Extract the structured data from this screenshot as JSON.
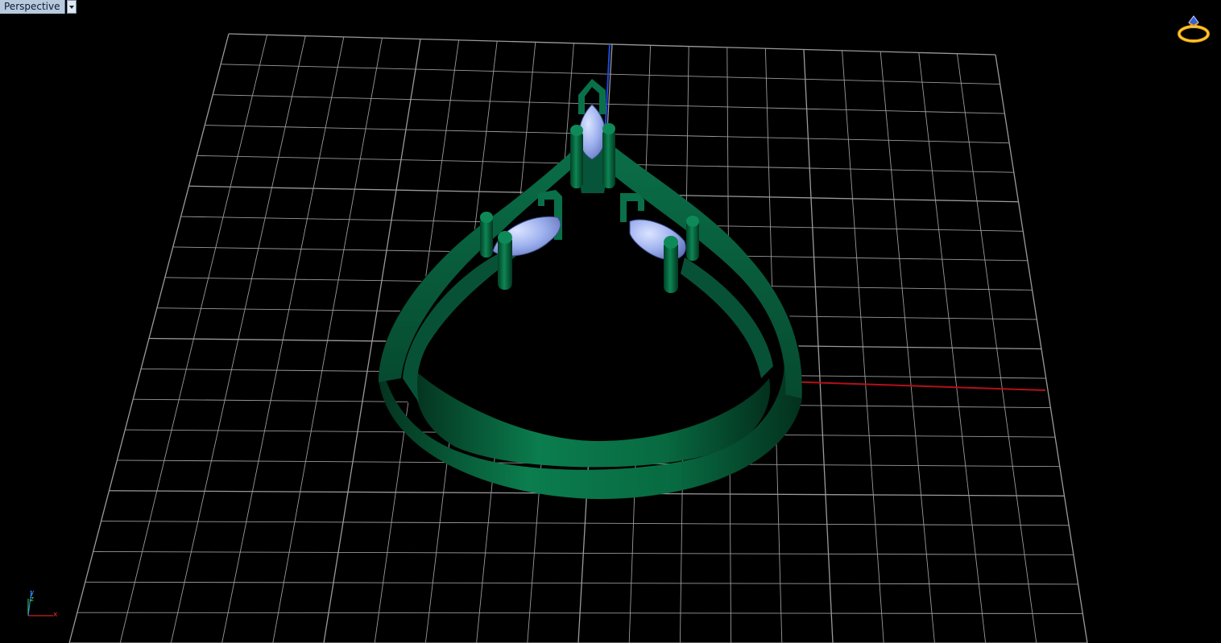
{
  "viewport": {
    "name": "Perspective",
    "menu_arrow": "dropdown-arrow-icon"
  },
  "axis_widget": {
    "y_label": "y",
    "z_label": "z",
    "x_label": "x",
    "colors": {
      "x": "#ff2a2a",
      "y": "#3c8cff",
      "z": "#3cd63c"
    }
  },
  "colors": {
    "background": "#000000",
    "grid": "#9a9a9a",
    "x_axis": "#b4101a",
    "y_axis": "#1f49d6",
    "metal": "#0a6b45",
    "gem": "#9fb2ef"
  },
  "icons": {
    "render": "ring-render-icon"
  }
}
